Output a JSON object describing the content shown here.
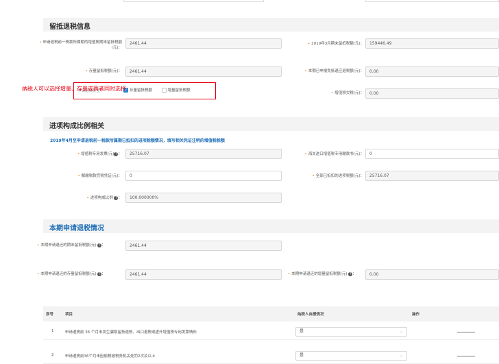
{
  "section1": {
    "title": "留抵退税信息",
    "fields": {
      "l1": "申请退税前一税款所属期的增值税期末留抵税额(元)：",
      "v1": "2461.44",
      "l2": "2019年3月期末留抵税额(元)：",
      "v2": "159446.49",
      "l3": "存量留抵税额(元)：",
      "v3": "2461.44",
      "l4": "本期已申报免抵退应退税额(元)：",
      "v4": "0.00",
      "l5": "增值税欠税(元)：",
      "v5": "0.00"
    },
    "annotation": "纳税人可以选择增量、存量或两者同时选择",
    "checkbox_hidden_label": "申请退税类型：",
    "checkbox_stock": "存量留抵税额",
    "checkbox_increment": "增量留抵税额"
  },
  "section2": {
    "title": "进项构成比例相关",
    "subtitle": "2019年4月至申请退税前一税款所属期已抵扣的进项税额情况，填写相关凭证注明的增值税税额",
    "fields": {
      "l1": "增值税专用发票(元)",
      "v1": "25716.07",
      "l2": "海关进口增值税专用缴款书(元)：",
      "v2": "0",
      "l3": "解缴税款完税凭证(元)：",
      "v3": "0",
      "l4": "全部已抵扣的进项税额(元)：",
      "v4": "25716.07",
      "l5": "进项构成比例",
      "v5": "100.000000%"
    }
  },
  "section3": {
    "title": "本期申请退税情况",
    "fields": {
      "l1": "本期申请退还的期末留抵税额(元)",
      "v1": "2461.44",
      "l2": "本期申请退还的存量留抵税额(元)",
      "v2": "2461.44",
      "l3": "本期申请退还的增量留抵税额(元)",
      "v3": "0.00"
    }
  },
  "table": {
    "headers": [
      "序号",
      "项目",
      "纳税人自报情况",
      "操作"
    ],
    "rows": [
      {
        "no": "1",
        "item": "申请退税前 36 个月未发生骗取留抵退税、出口退税或虚开增值税专用发票情形",
        "answer": "是"
      },
      {
        "no": "2",
        "item": "申请退税前36个月未因偷税被税务机关处罚2次及以上",
        "answer": "是"
      }
    ]
  }
}
